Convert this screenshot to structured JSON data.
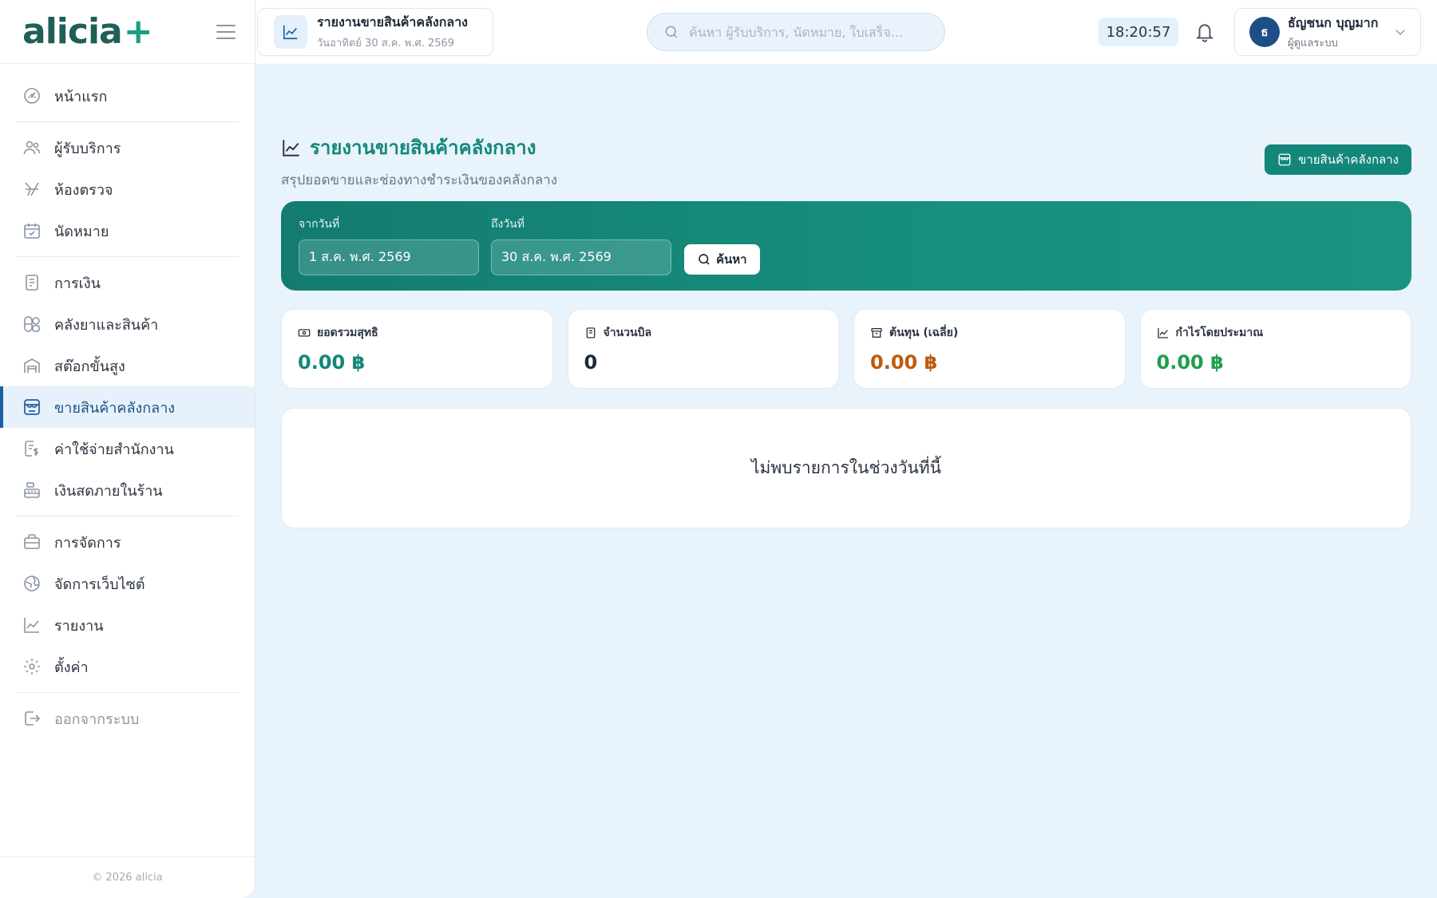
{
  "brand": {
    "logo_text": "alicia",
    "logo_plus": "+",
    "accent": "#13877a"
  },
  "header": {
    "page_chip_title": "รายงานขายสินค้าคลังกลาง",
    "page_chip_date": "วันอาทิตย์ 30 ส.ค. พ.ศ. 2569",
    "search_placeholder": "ค้นหา ผู้รับบริการ, นัดหมาย, ใบเสร็จ...",
    "clock": "18:20:57",
    "user": {
      "initial": "ธ",
      "name": "ธัญชนก บุญมาก",
      "role": "ผู้ดูแลระบบ"
    }
  },
  "sidebar": {
    "groups": [
      [
        {
          "label": "หน้าแรก",
          "icon": "dashboard-icon"
        }
      ],
      [
        {
          "label": "ผู้รับบริการ",
          "icon": "users-icon"
        },
        {
          "label": "ห้องตรวจ",
          "icon": "stethoscope-icon"
        },
        {
          "label": "นัดหมาย",
          "icon": "calendar-icon"
        }
      ],
      [
        {
          "label": "การเงิน",
          "icon": "receipt-icon"
        },
        {
          "label": "คลังยาและสินค้า",
          "icon": "pills-icon"
        },
        {
          "label": "สต๊อกขั้นสูง",
          "icon": "warehouse-icon"
        },
        {
          "label": "ขายสินค้าคลังกลาง",
          "icon": "store-icon",
          "active": true
        },
        {
          "label": "ค่าใช้จ่ายสำนักงาน",
          "icon": "expense-icon"
        },
        {
          "label": "เงินสดภายในร้าน",
          "icon": "cash-register-icon"
        }
      ],
      [
        {
          "label": "การจัดการ",
          "icon": "briefcase-icon"
        },
        {
          "label": "จัดการเว็บไซต์",
          "icon": "globe-icon"
        },
        {
          "label": "รายงาน",
          "icon": "chart-line-icon"
        },
        {
          "label": "ตั้งค่า",
          "icon": "gear-icon"
        }
      ]
    ],
    "logout_label": "ออกจากระบบ",
    "footer": "© 2026 alicia"
  },
  "main": {
    "title": "รายงานขายสินค้าคลังกลาง",
    "subtitle": "สรุปยอดขายและช่องทางชำระเงินของคลังกลาง",
    "sell_button_label": "ขายสินค้าคลังกลาง",
    "filter": {
      "from_label": "จากวันที่",
      "from_value": "1 ส.ค. พ.ศ. 2569",
      "to_label": "ถึงวันที่",
      "to_value": "30 ส.ค. พ.ศ. 2569",
      "search_button_label": "ค้นหา"
    },
    "cards": [
      {
        "label": "ยอดรวมสุทธิ",
        "value": "0.00 ฿",
        "color": "#13877a",
        "icon": "cash-icon"
      },
      {
        "label": "จำนวนบิล",
        "value": "0",
        "color": "#1f2a37",
        "icon": "bill-icon"
      },
      {
        "label": "ต้นทุน (เฉลี่ย)",
        "value": "0.00 ฿",
        "color": "#c0590c",
        "icon": "box-icon"
      },
      {
        "label": "กำไรโดยประมาณ",
        "value": "0.00 ฿",
        "color": "#1f9d4f",
        "icon": "trend-icon"
      }
    ],
    "empty_message": "ไม่พบรายการในช่วงวันที่นี้"
  }
}
